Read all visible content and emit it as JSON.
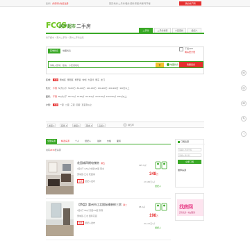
{
  "topbar": {
    "left_prefix": "您好！",
    "login": "[请登录]",
    "register": "免费注册",
    "links": [
      "首页",
      "新房",
      "二手房",
      "租房",
      "装修",
      "家居",
      "商铺",
      "写字楼"
    ],
    "button": "我的房产网"
  },
  "brand": {
    "logo": "FCCS",
    "logo_cn": "房产超市",
    "section": "二手房"
  },
  "nav": [
    "二手房",
    "二手房搜索",
    "小区查找",
    "经纪人"
  ],
  "breadcrumb": "房产超市 > 惠州二手房 > 惠州二手房出售",
  "search": {
    "tab_active": "区域找房",
    "tab_other": "地图找房",
    "placeholder": "请输入区域、板块、小区或地址",
    "button_icon": "search",
    "map_link": "地图找房"
  },
  "app_promo": {
    "line1": "下载APP",
    "line2": "看房更方便"
  },
  "entrust_button": "我要卖房",
  "filters": [
    {
      "label": "区域：",
      "active": "不限",
      "items": [
        "惠城区",
        "惠阳区",
        "博罗县",
        "仲恺",
        "大亚湾",
        "惠东",
        "龙门"
      ]
    },
    {
      "label": "售价：",
      "active": "不限",
      "items": [
        "50万以下",
        "50-80万",
        "80-100万",
        "100-150万",
        "150-200万",
        "200-300万",
        "300万以上"
      ]
    },
    {
      "label": "面积：",
      "active": "不限",
      "items": [
        "50㎡以下",
        "50-70㎡",
        "70-90㎡",
        "90-110㎡",
        "110-130㎡",
        "130-150㎡",
        "150㎡以上"
      ]
    },
    {
      "label": "户型：",
      "active": "不限",
      "items": [
        "一室",
        "二室",
        "三室",
        "四室",
        "五室及以上"
      ]
    }
  ],
  "sorter": {
    "dropdowns": [
      "类型",
      "装修",
      "楼层",
      "朝向",
      "房龄"
    ],
    "checkbox_label": "满五年"
  },
  "list_tabs": {
    "active": "全部房源",
    "hot": "精选房源",
    "items": [
      "个人",
      "经纪人",
      "最新",
      "价格",
      "面积"
    ]
  },
  "total": {
    "prefix": "共有",
    "count": "2316",
    "suffix": "套房源"
  },
  "listings": [
    {
      "title": "花园城四期电梯房",
      "tag": "满五",
      "l2": "3室2厅  125㎡  中层/28层  南北",
      "l3": "惠城区-江北  花园城",
      "badge": "急售",
      "l4": "经纪人发布",
      "area": "125.7㎡",
      "price": "348",
      "price_unit": "万",
      "unit_price": "27,685元/㎡",
      "agent": "经纪人"
    },
    {
      "title": "【笋盘】惠州市江北国际精装修三房",
      "tag": "满二",
      "l2": "3室2厅  98㎡  高层/32层  东南",
      "l3": "惠城区-江北  国际花园",
      "badge": "急售",
      "l4": "经纪人发布",
      "area": "98.3㎡",
      "price": "198",
      "price_unit": "万",
      "unit_price": "20,142元/㎡",
      "agent": "经纪人"
    }
  ],
  "side": {
    "subscribe_title": "订阅房源",
    "subscribe_inputs": [
      "请输入手机号码",
      "请输入验证码"
    ],
    "subscribe_button": "立即订阅",
    "ad_title": "推荐房源",
    "ad_big": "找房网",
    "ad_small": "买房卖房一站式服务"
  },
  "float_icons": [
    "phone-icon",
    "wechat-icon",
    "chat-icon",
    "feedback-icon",
    "top-icon"
  ],
  "colors": {
    "green": "#39a826",
    "red": "#e52e2e",
    "yellow": "#f2c12e"
  }
}
